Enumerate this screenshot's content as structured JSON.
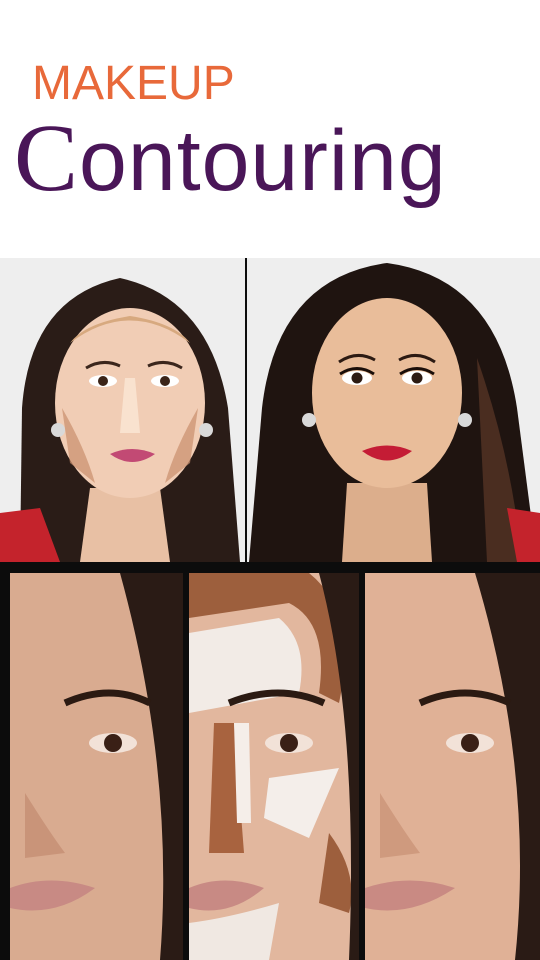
{
  "header": {
    "eyebrow": "MAKEUP",
    "title_initial": "C",
    "title_rest": "ontouring"
  },
  "colors": {
    "eyebrow": "#E8693A",
    "title": "#4A1658",
    "background": "#FFFFFF",
    "frame": "#0C0C0C"
  },
  "photos": {
    "top": [
      {
        "name": "contour-applied-portrait"
      },
      {
        "name": "finished-look-portrait"
      }
    ],
    "bottom": [
      {
        "name": "before-closeup"
      },
      {
        "name": "contour-map-closeup"
      },
      {
        "name": "after-closeup"
      }
    ]
  }
}
